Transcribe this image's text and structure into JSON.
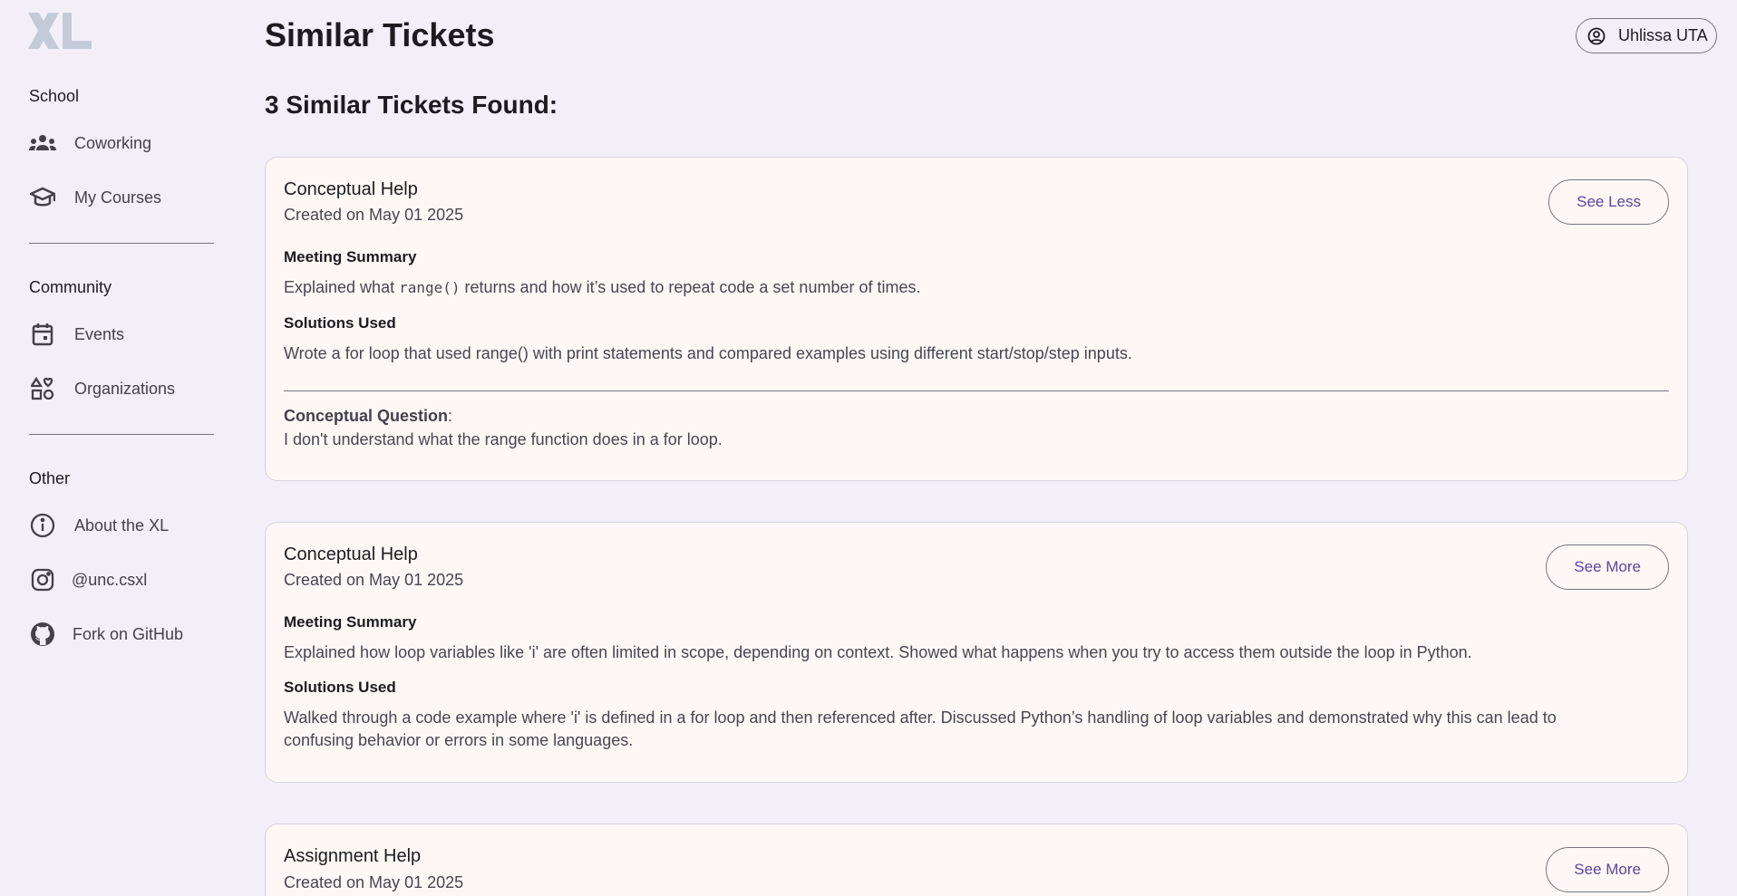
{
  "sidebar": {
    "sections": [
      {
        "label": "School",
        "items": [
          {
            "label": "Coworking",
            "icon": "group-icon"
          },
          {
            "label": "My Courses",
            "icon": "school-icon"
          }
        ]
      },
      {
        "label": "Community",
        "items": [
          {
            "label": "Events",
            "icon": "calendar-icon"
          },
          {
            "label": "Organizations",
            "icon": "category-icon"
          }
        ]
      },
      {
        "label": "Other",
        "items": [
          {
            "label": "About the XL",
            "icon": "info-icon"
          },
          {
            "label": "@unc.csxl",
            "icon": "instagram-icon"
          },
          {
            "label": "Fork on GitHub",
            "icon": "github-icon"
          }
        ]
      }
    ]
  },
  "header": {
    "title": "Similar Tickets",
    "user_chip": "Uhlissa UTA"
  },
  "results": {
    "heading": "3 Similar Tickets Found:"
  },
  "tickets": [
    {
      "type": "Conceptual Help",
      "created": "Created on May 01 2025",
      "button": "See Less",
      "summary_heading": "Meeting Summary",
      "summary_pre": "Explained what ",
      "summary_code": "range()",
      "summary_post": " returns and how it’s used to repeat code a set number of times.",
      "solutions_heading": "Solutions Used",
      "solutions": "Wrote a for loop that used range() with print statements and compared examples using different start/stop/step inputs.",
      "question_label": "Conceptual Question",
      "question_colon": ":",
      "question": "I don't understand what the range function does in a for loop."
    },
    {
      "type": "Conceptual Help",
      "created": "Created on May 01 2025",
      "button": "See More",
      "summary_heading": "Meeting Summary",
      "summary": "Explained how loop variables like 'i' are often limited in scope, depending on context. Showed what happens when you try to access them outside the loop in Python.",
      "solutions_heading": "Solutions Used",
      "solutions": "Walked through a code example where 'i' is defined in a for loop and then referenced after. Discussed Python’s handling of loop variables and demonstrated why this can lead to confusing behavior or errors in some languages."
    },
    {
      "type": "Assignment Help",
      "created": "Created on May 01 2025",
      "button": "See More"
    }
  ],
  "colors": {
    "background": "#f3eff9",
    "card": "#fdf8f6",
    "accent": "#5b45a0",
    "icon": "#44414a"
  }
}
